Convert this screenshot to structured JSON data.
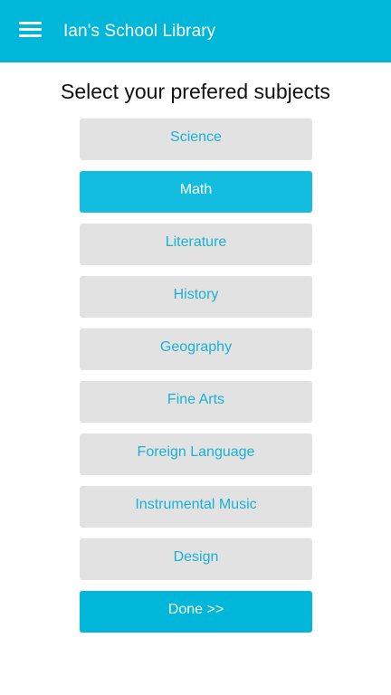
{
  "appbar": {
    "title": "Ian's School Library",
    "menu_icon": "hamburger-menu-icon",
    "background": "#00b7da"
  },
  "page": {
    "heading": "Select your prefered subjects"
  },
  "subjects": [
    {
      "label": "Science",
      "selected": false
    },
    {
      "label": "Math",
      "selected": true
    },
    {
      "label": "Literature",
      "selected": false
    },
    {
      "label": "History",
      "selected": false
    },
    {
      "label": "Geography",
      "selected": false
    },
    {
      "label": "Fine Arts",
      "selected": false
    },
    {
      "label": "Foreign Language",
      "selected": false
    },
    {
      "label": "Instrumental Music",
      "selected": false
    },
    {
      "label": "Design",
      "selected": false
    }
  ],
  "done_button": {
    "label": "Done >>"
  },
  "colors": {
    "accent": "#00b7da",
    "unselected_bg": "#e2e2e2",
    "unselected_text": "#1ab1d6",
    "selected_text": "#ffffff"
  }
}
